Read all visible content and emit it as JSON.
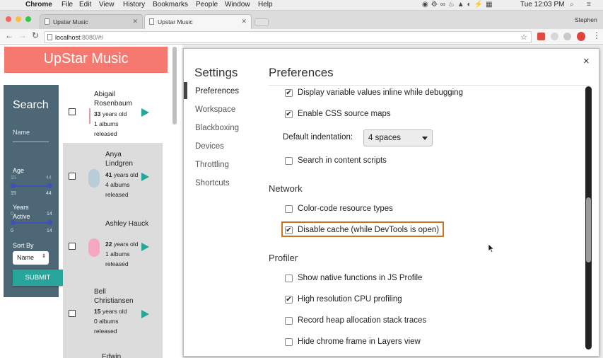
{
  "menubar": {
    "app_name": "Chrome",
    "items": [
      "File",
      "Edit",
      "View",
      "History",
      "Bookmarks",
      "People",
      "Window",
      "Help"
    ],
    "clock": "Tue 12:03 PM",
    "user": "Stephen"
  },
  "tabs": [
    {
      "label": "Upstar Music"
    },
    {
      "label": "Upstar Music"
    }
  ],
  "address": {
    "url_host": "localhost",
    "url_rest": ":8080/#/"
  },
  "app": {
    "title": "UpStar Music",
    "search": {
      "heading": "Search",
      "name_label": "Name",
      "age_label": "Age",
      "age_min": "15",
      "age_max": "44",
      "age_min2": "15",
      "age_max2": "44",
      "years_label": "Years",
      "active_label": "Active",
      "years_min": "0",
      "years_max": "14",
      "years_min_top": "0",
      "years_max_top": "14",
      "sort_label": "Sort By",
      "sort_value": "Name",
      "submit_label": "SUBMIT"
    },
    "artists": [
      {
        "name": "Abigail Rosenbaum",
        "age": "33",
        "age_suffix": " years old",
        "albums": "1 albums released"
      },
      {
        "name": "Anya Lindgren",
        "age": "41",
        "age_suffix": " years old",
        "albums": "4 albums released"
      },
      {
        "name": "Ashley Hauck",
        "age": "22",
        "age_suffix": " years old",
        "albums": "1 albums released"
      },
      {
        "name": "Bell Christiansen",
        "age": "15",
        "age_suffix": " years old",
        "albums": "0 albums released"
      },
      {
        "name": "Edwin",
        "age": "",
        "age_suffix": "",
        "albums": ""
      }
    ]
  },
  "settings": {
    "title": "Settings",
    "nav": [
      "Preferences",
      "Workspace",
      "Blackboxing",
      "Devices",
      "Throttling",
      "Shortcuts"
    ],
    "panel_title": "Preferences",
    "options_top": [
      {
        "label": "Display variable values inline while debugging",
        "checked": true
      },
      {
        "label": "Enable CSS source maps",
        "checked": true
      }
    ],
    "indentation_label": "Default indentation:",
    "indentation_value": "4 spaces",
    "search_scripts": {
      "label": "Search in content scripts",
      "checked": false
    },
    "network_heading": "Network",
    "network_options": [
      {
        "label": "Color-code resource types",
        "checked": false
      },
      {
        "label": "Disable cache (while DevTools is open)",
        "checked": true
      }
    ],
    "profiler_heading": "Profiler",
    "profiler_options": [
      {
        "label": "Show native functions in JS Profile",
        "checked": false
      },
      {
        "label": "High resolution CPU profiling",
        "checked": true
      },
      {
        "label": "Record heap allocation stack traces",
        "checked": false
      },
      {
        "label": "Hide chrome frame in Layers view",
        "checked": false
      }
    ],
    "close_glyph": "×",
    "highlight_color": "#c7761f"
  }
}
